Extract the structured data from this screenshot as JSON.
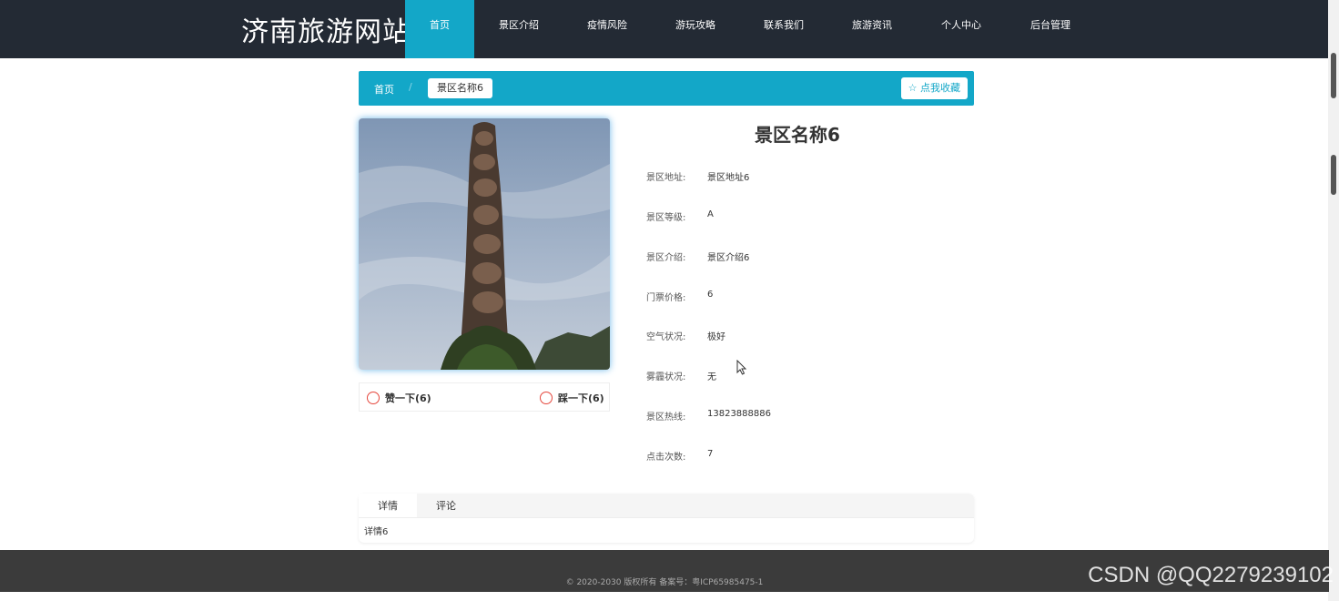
{
  "header": {
    "site_title": "济南旅游网站",
    "nav": [
      "首页",
      "景区介绍",
      "疫情风险",
      "游玩攻略",
      "联系我们",
      "旅游资讯",
      "个人中心",
      "后台管理"
    ]
  },
  "breadcrumb": {
    "home": "首页",
    "separator": "/",
    "current": "景区名称6",
    "favorite": "☆ 点我收藏"
  },
  "detail": {
    "title": "景区名称6",
    "rows": [
      {
        "label": "景区地址:",
        "value": "景区地址6"
      },
      {
        "label": "景区等级:",
        "value": "A"
      },
      {
        "label": "景区介绍:",
        "value": "景区介绍6"
      },
      {
        "label": "门票价格:",
        "value": "6"
      },
      {
        "label": "空气状况:",
        "value": "极好"
      },
      {
        "label": "雾霾状况:",
        "value": "无"
      },
      {
        "label": "景区热线:",
        "value": "13823888886"
      },
      {
        "label": "点击次数:",
        "value": "7"
      }
    ]
  },
  "votes": {
    "like": "赞一下(6)",
    "dislike": "踩一下(6)"
  },
  "tabs": {
    "items": [
      "详情",
      "评论"
    ],
    "content": "详情6"
  },
  "footer": {
    "text": "© 2020-2030 版权所有 备案号：粤ICP65985475-1"
  },
  "watermark": "CSDN @QQ2279239102",
  "colors": {
    "accent": "#13a7c8",
    "header_bg": "#232a34",
    "footer_bg": "#3b3b3b"
  }
}
